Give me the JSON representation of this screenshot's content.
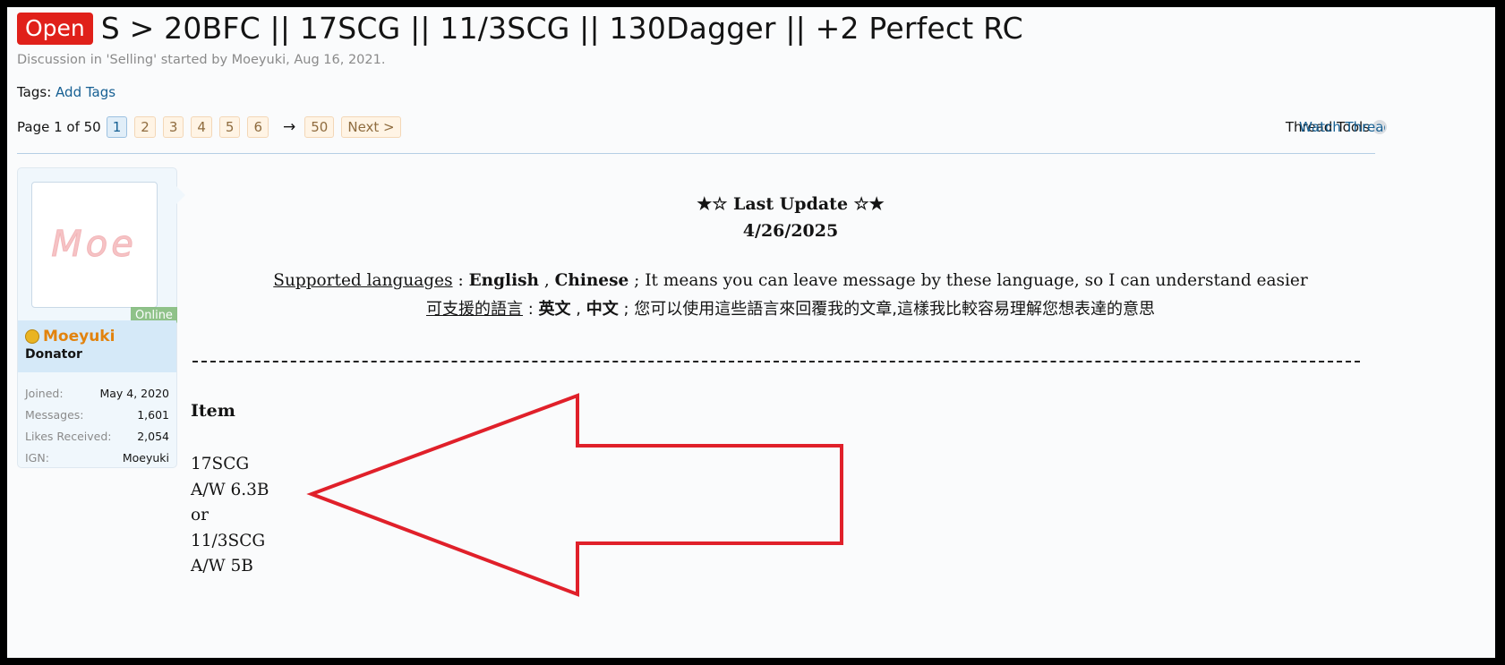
{
  "thread": {
    "prefix": "Open",
    "title": "S > 20BFC || 17SCG || 11/3SCG || 130Dagger || +2 Perfect RC",
    "meta": "Discussion in 'Selling' started by Moeyuki, Aug 16, 2021.",
    "tags_label": "Tags:",
    "add_tags": "Add Tags"
  },
  "pagenav": {
    "label": "Page 1 of 50",
    "pages": [
      "1",
      "2",
      "3",
      "4",
      "5",
      "6"
    ],
    "arrow": "→",
    "last": "50",
    "next": "Next >"
  },
  "tools": {
    "thread_tools": "Thread Tools",
    "watch": "Watch Thread"
  },
  "user": {
    "avatar_text": "Moe",
    "online": "Online",
    "name": "Moeyuki",
    "title": "Donator",
    "stats": [
      {
        "k": "Joined:",
        "v": "May 4, 2020"
      },
      {
        "k": "Messages:",
        "v": "1,601"
      },
      {
        "k": "Likes Received:",
        "v": "2,054"
      },
      {
        "k": "IGN:",
        "v": "Moeyuki"
      }
    ]
  },
  "post": {
    "last_update": "★☆ Last Update ☆★",
    "date": "4/26/2025",
    "lang_label_en": "Supported languages",
    "lang_sep": " : ",
    "lang_en_1": "English",
    "comma": " , ",
    "lang_en_2": "Chinese",
    "lang_en_rest": " ; It means you can leave message by these language, so I can understand easier",
    "lang_label_zh": "可支援的語言",
    "lang_zh_1": "英文",
    "lang_zh_2": "中文",
    "lang_zh_rest": " ; 您可以使用這些語言來回覆我的文章,這樣我比較容易理解您想表達的意思",
    "item_heading": "Item",
    "items": [
      "17SCG",
      "A/W 6.3B",
      "or",
      "11/3SCG",
      "A/W 5B"
    ]
  },
  "colors": {
    "prefix_bg": "#e0201a",
    "link": "#176093",
    "username": "#e2830e",
    "arrow_annotation": "#e0202a"
  }
}
